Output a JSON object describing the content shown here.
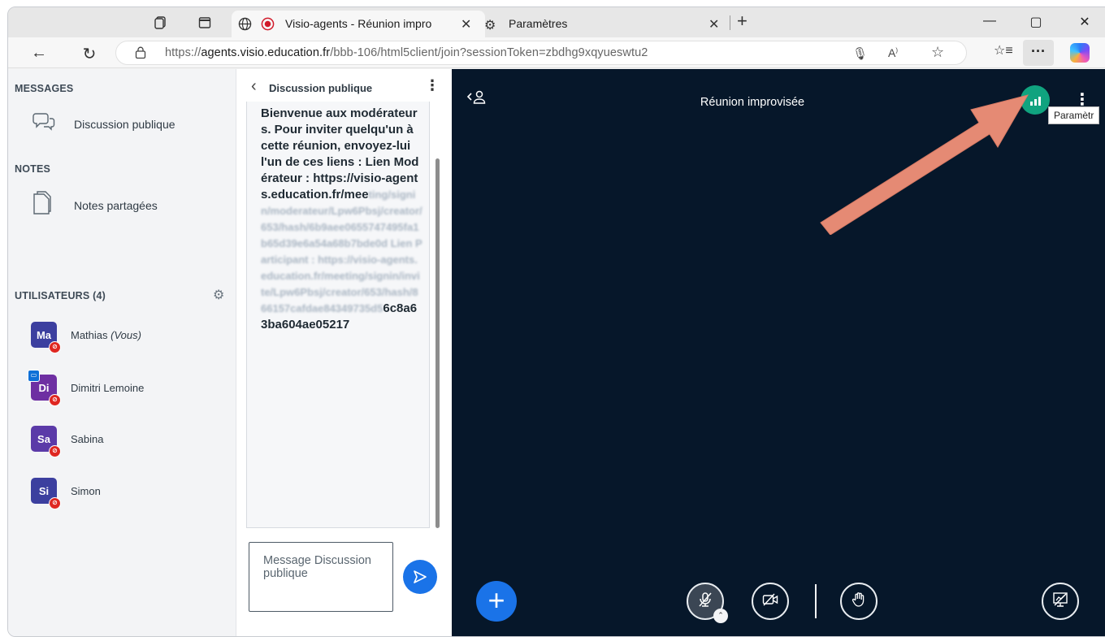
{
  "browser": {
    "tabs": [
      {
        "title": "Visio-agents - Réunion impro",
        "close": "✕"
      },
      {
        "title": "Paramètres",
        "close": "✕"
      }
    ],
    "new_tab": "+",
    "url_prefix": "https://",
    "url_domain": "agents.visio.education.fr",
    "url_path": "/bbb-106/html5client/join?sessionToken=zbdhg9xqyueswtu2",
    "more_label": "···",
    "tooltip": "Paramètr"
  },
  "sidebar": {
    "messages_head": "MESSAGES",
    "public_chat": "Discussion publique",
    "notes_head": "NOTES",
    "shared_notes": "Notes partagées",
    "users_head": "UTILISATEURS (4)",
    "users": [
      {
        "initials": "Ma",
        "name": "Mathias",
        "suffix": "(Vous)",
        "color": "#3c3f9f"
      },
      {
        "initials": "Di",
        "name": "Dimitri Lemoine",
        "suffix": "",
        "color": "#6e2fa2"
      },
      {
        "initials": "Sa",
        "name": "Sabina",
        "suffix": "",
        "color": "#5b3aa8"
      },
      {
        "initials": "Si",
        "name": "Simon",
        "suffix": "",
        "color": "#3c3f9f"
      }
    ]
  },
  "chat": {
    "title": "Discussion publique",
    "message_main": "Bienvenue aux modérateurs. Pour inviter quelqu'un à cette réunion, envoyez-lui l'un de ces liens : Lien Modérateur : https://visio-agents.education.fr/mee",
    "message_blurred": "ting/signin/moderateur/Lpw6Pbsj/creator/653/hash/6b9aee0655747495fa1b65d39e6a54a68b7bde0d Lien Participant : https://visio-agents.education.fr/meeting/signin/invite/Lpw6Pbsj/creator/653/hash/866157cafdae84349735d5",
    "message_tail": "6c8a63ba604ae05217",
    "input_placeholder": "Message Discussion publique"
  },
  "stage": {
    "title": "Réunion improvisée"
  },
  "colors": {
    "stage_bg": "#06172a",
    "accent": "#1a73e8",
    "connection": "#10a37f",
    "muted": "#df2721",
    "arrow": "#e58a74"
  }
}
